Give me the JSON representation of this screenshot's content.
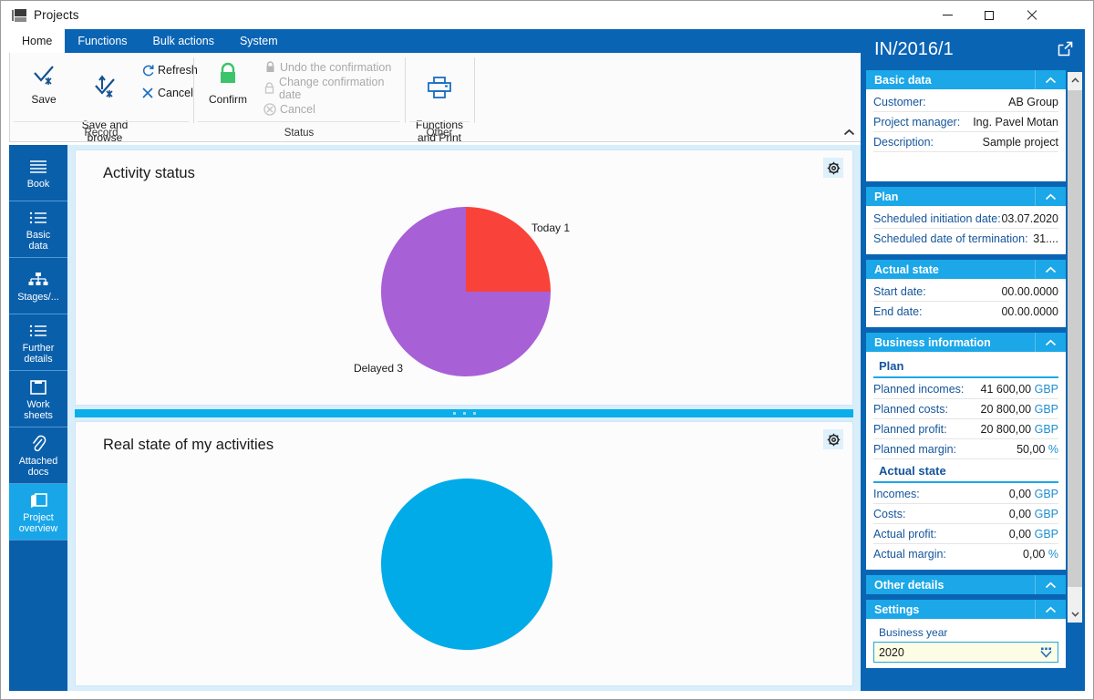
{
  "window": {
    "title": "Projects",
    "icon": "app-icon",
    "minimize_label": "Minimize",
    "maximize_label": "Maximize",
    "close_label": "Close"
  },
  "ribbon": {
    "tabs": [
      {
        "label": "Home",
        "active": true
      },
      {
        "label": "Functions",
        "active": false
      },
      {
        "label": "Bulk actions",
        "active": false
      },
      {
        "label": "System",
        "active": false
      }
    ],
    "groups": [
      {
        "label": "Record"
      },
      {
        "label": "Status"
      },
      {
        "label": "Other"
      }
    ],
    "record": {
      "save": "Save",
      "save_and_browse": "Save and\nbrowse",
      "refresh": "Refresh",
      "cancel": "Cancel"
    },
    "status": {
      "confirm": "Confirm",
      "undo_confirmation": "Undo the confirmation",
      "change_confirmation_date": "Change confirmation date",
      "cancel": "Cancel"
    },
    "other": {
      "functions_and_print": "Functions\nand Print"
    },
    "collapse_label": "Collapse the Ribbon"
  },
  "sidebar": {
    "items": [
      {
        "label": "Book",
        "icon": "list-lines-icon",
        "selected": false
      },
      {
        "label": "Basic\ndata",
        "icon": "bullet-list-icon",
        "selected": false
      },
      {
        "label": "Stages/...",
        "icon": "hierarchy-icon",
        "selected": false
      },
      {
        "label": "Further\ndetails",
        "icon": "bullet-list-icon",
        "selected": false
      },
      {
        "label": "Work\nsheets",
        "icon": "box-icon",
        "selected": false
      },
      {
        "label": "Attached\ndocs",
        "icon": "paperclip-icon",
        "selected": false
      },
      {
        "label": "Project\noverview",
        "icon": "panels-icon",
        "selected": true
      }
    ]
  },
  "main": {
    "panels": [
      {
        "title": "Activity status",
        "gear": "settings-gear-icon"
      },
      {
        "title": "Real state of my activities",
        "gear": "settings-gear-icon"
      }
    ],
    "splitter": "panel-splitter"
  },
  "chart_data": [
    {
      "type": "pie",
      "title": "Activity status",
      "categories": [
        "Today",
        "Delayed"
      ],
      "values": [
        1,
        3
      ],
      "labels": [
        "Today 1",
        "Delayed 3"
      ],
      "colors": [
        "#f9423a",
        "#a860d6"
      ],
      "legend": "none",
      "total": 4
    },
    {
      "type": "pie",
      "title": "Real state of my activities",
      "categories": [
        ""
      ],
      "values": [
        1
      ],
      "labels": [
        ""
      ],
      "colors": [
        "#00abe8"
      ],
      "legend": "none",
      "total": 1
    }
  ],
  "rightpanel": {
    "title": "IN/2016/1",
    "expand_icon": "open-in-new-window-icon",
    "sections": [
      {
        "name": "basic-data",
        "title": "Basic data",
        "rows": [
          {
            "key": "Customer:",
            "value": "AB Group"
          },
          {
            "key": "Project manager:",
            "value": "Ing. Pavel Motan"
          },
          {
            "key": "Description:",
            "value": "Sample project"
          }
        ]
      },
      {
        "name": "plan",
        "title": "Plan",
        "rows": [
          {
            "key": "Scheduled initiation date:",
            "value": "03.07.2020"
          },
          {
            "key": "Scheduled date of termination:",
            "value": "31...."
          }
        ]
      },
      {
        "name": "actual-state",
        "title": "Actual state",
        "rows": [
          {
            "key": "Start date:",
            "value": "00.00.0000"
          },
          {
            "key": "End date:",
            "value": "00.00.0000"
          }
        ]
      },
      {
        "name": "business-information",
        "title": "Business information",
        "sub_plan": "Plan",
        "plan_rows": [
          {
            "key": "Planned incomes:",
            "value": "41 600,00",
            "currency": "GBP"
          },
          {
            "key": "Planned costs:",
            "value": "20 800,00",
            "currency": "GBP"
          },
          {
            "key": "Planned profit:",
            "value": "20 800,00",
            "currency": "GBP"
          },
          {
            "key": "Planned margin:",
            "value": "50,00",
            "currency": "%"
          }
        ],
        "sub_actual": "Actual state",
        "actual_rows": [
          {
            "key": "Incomes:",
            "value": "0,00",
            "currency": "GBP"
          },
          {
            "key": "Costs:",
            "value": "0,00",
            "currency": "GBP"
          },
          {
            "key": "Actual profit:",
            "value": "0,00",
            "currency": "GBP"
          },
          {
            "key": "Actual margin:",
            "value": "0,00",
            "currency": "%"
          }
        ]
      },
      {
        "name": "other-details",
        "title": "Other details"
      },
      {
        "name": "settings",
        "title": "Settings",
        "field_label": "Business year",
        "field_value": "2020"
      }
    ]
  },
  "colors": {
    "brand_dark_blue": "#0a64b4",
    "brand_light_blue": "#1ba7e8",
    "accent_cyan": "#00abe8",
    "pie_red": "#f9423a",
    "pie_purple": "#a860d6",
    "confirm_green": "#3dc46a",
    "content_bg": "#d8eefb"
  }
}
